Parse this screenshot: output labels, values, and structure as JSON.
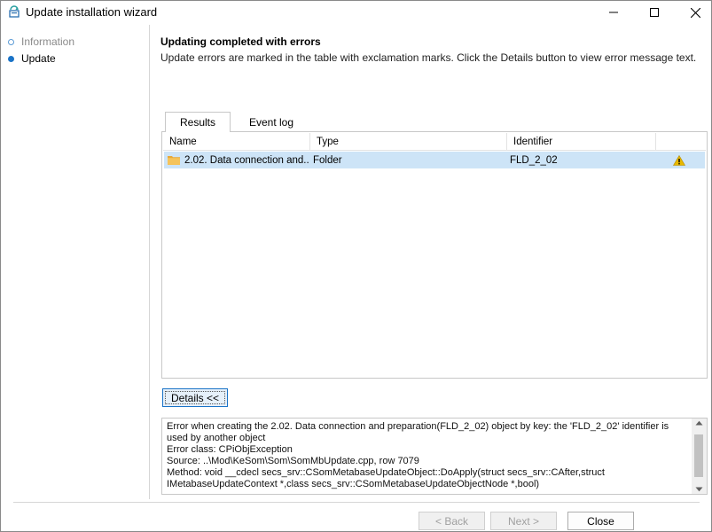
{
  "window": {
    "title": "Update installation wizard"
  },
  "steps": [
    {
      "label": "Information",
      "state": "inactive"
    },
    {
      "label": "Update",
      "state": "active"
    }
  ],
  "header": {
    "title": "Updating completed with errors",
    "description": "Update errors are marked in the table with exclamation marks. Click the Details button to view error message text."
  },
  "tabs": [
    {
      "label": "Results",
      "selected": true
    },
    {
      "label": "Event log",
      "selected": false
    }
  ],
  "table": {
    "columns": [
      "Name",
      "Type",
      "Identifier",
      ""
    ],
    "rows": [
      {
        "name": "2.02. Data connection and...",
        "type": "Folder",
        "identifier": "FLD_2_02",
        "status_icon": "warning-icon"
      }
    ]
  },
  "details_button": {
    "label": "Details <<"
  },
  "details": {
    "lines": [
      "Error when creating the 2.02. Data connection and preparation(FLD_2_02) object by key: the 'FLD_2_02' identifier is",
      "used by another object",
      "Error class: CPiObjException",
      "Source: ..\\Mod\\KeSom\\Som\\SomMbUpdate.cpp, row 7079",
      "Method: void __cdecl secs_srv::CSomMetabaseUpdateObject::DoApply(struct secs_srv::CAfter,struct",
      "IMetabaseUpdateContext *,class secs_srv::CSomMetabaseUpdateObjectNode *,bool)"
    ]
  },
  "footer": {
    "back_label": "< Back",
    "next_label": "Next >",
    "close_label": "Close"
  },
  "colors": {
    "accent": "#1a73c7",
    "selection": "#cde4f7",
    "warning": "#e8b800"
  }
}
